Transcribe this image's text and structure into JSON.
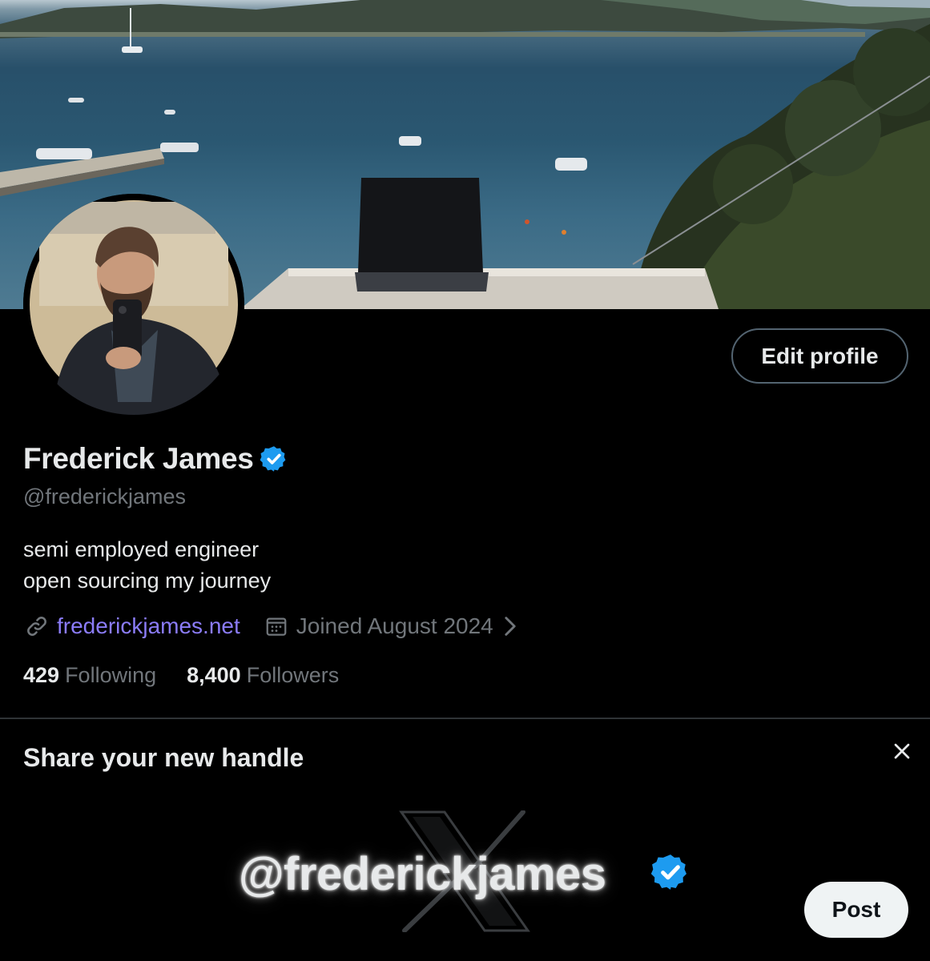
{
  "profile": {
    "display_name": "Frederick James",
    "handle": "@frederickjames",
    "bio_line1": "semi employed engineer",
    "bio_line2": "open sourcing my journey",
    "website": "frederickjames.net",
    "joined": "Joined August 2024",
    "following_count": "429",
    "following_label": "Following",
    "followers_count": "8,400",
    "followers_label": "Followers",
    "edit_label": "Edit profile",
    "verified_icon": "verified-badge-icon"
  },
  "share_card": {
    "title": "Share your new handle",
    "handle": "@frederickjames",
    "post_label": "Post",
    "logo": "x-logo-icon"
  },
  "colors": {
    "background": "#000000",
    "text": "#e7e9ea",
    "muted": "#71767b",
    "link": "#8b7cf8",
    "verified": "#1d9bf0",
    "divider": "#2f3336"
  }
}
